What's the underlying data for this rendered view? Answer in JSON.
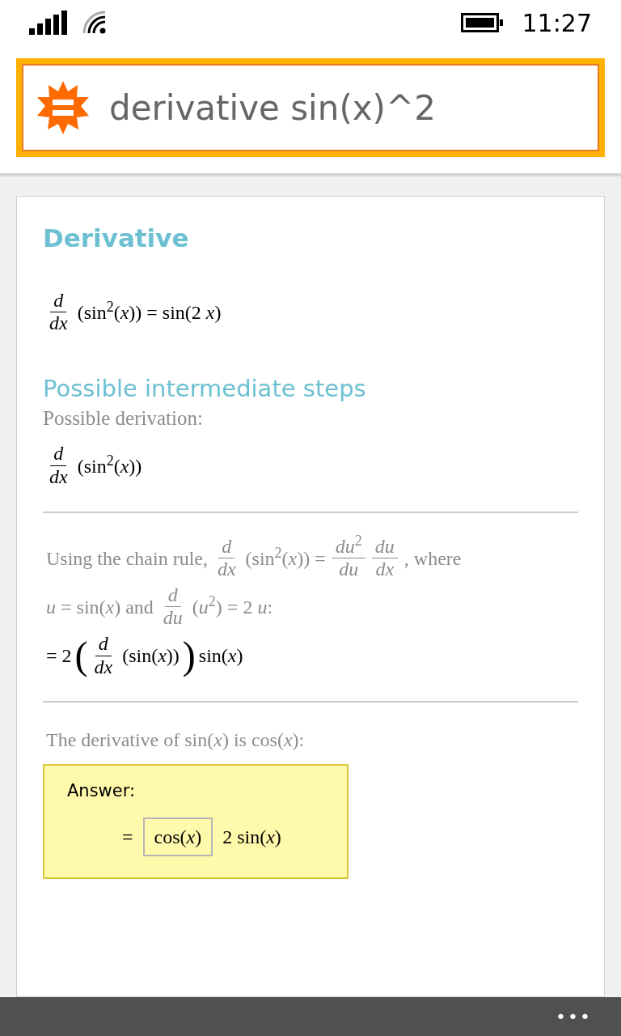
{
  "status_bar": {
    "time": "11:27"
  },
  "search": {
    "value": "derivative sin(x)^2"
  },
  "result": {
    "title": "Derivative",
    "formula": [
      {
        "kind": "frac",
        "num": "*d*",
        "den": "*dx*"
      },
      {
        "kind": "text",
        "s": "(sin$^{2}$(*x*)) = sin(2 *x*)"
      }
    ],
    "steps_title": "Possible intermediate steps",
    "steps_subtitle": "Possible derivation:",
    "start": [
      {
        "kind": "frac",
        "num": "*d*",
        "den": "*dx*"
      },
      {
        "kind": "text",
        "s": "(sin$^{2}$(*x*))"
      }
    ],
    "steps": [
      {
        "lines": [
          {
            "muted": true,
            "parts": [
              {
                "kind": "text",
                "s": "Using the chain rule,"
              },
              {
                "kind": "frac",
                "num": "*d*",
                "den": "*dx*"
              },
              {
                "kind": "text",
                "s": "(sin$^{2}$(*x*)) ="
              },
              {
                "kind": "frac",
                "num": "*du*$^{2}$",
                "den": "*du*"
              },
              {
                "kind": "frac",
                "num": "*du*",
                "den": "*dx*"
              },
              {
                "kind": "text",
                "s": ", where"
              }
            ]
          },
          {
            "muted": true,
            "parts": [
              {
                "kind": "text",
                "s": "*u* = sin(*x*) and"
              },
              {
                "kind": "frac",
                "num": "*d*",
                "den": "*du*"
              },
              {
                "kind": "text",
                "s": "(*u*$^{2}$) = 2 *u*:"
              }
            ]
          },
          {
            "muted": false,
            "parts": [
              {
                "kind": "text",
                "s": "= 2"
              },
              {
                "kind": "paren",
                "s": "("
              },
              {
                "kind": "frac",
                "num": "*d*",
                "den": "*dx*"
              },
              {
                "kind": "text",
                "s": "(sin(*x*))"
              },
              {
                "kind": "paren",
                "s": ")"
              },
              {
                "kind": "text",
                "s": "sin(*x*)"
              }
            ]
          }
        ]
      },
      {
        "lines": [
          {
            "muted": true,
            "parts": [
              {
                "kind": "text",
                "s": "The derivative of sin(*x*) is cos(*x*):"
              }
            ]
          }
        ]
      }
    ],
    "answer": {
      "label": "Answer:",
      "parts": [
        {
          "kind": "text",
          "s": "="
        },
        {
          "kind": "boxed",
          "s": "cos(*x*)"
        },
        {
          "kind": "text",
          "s": "2 sin(*x*)"
        }
      ]
    }
  },
  "app_bar": {
    "more": "•••"
  }
}
